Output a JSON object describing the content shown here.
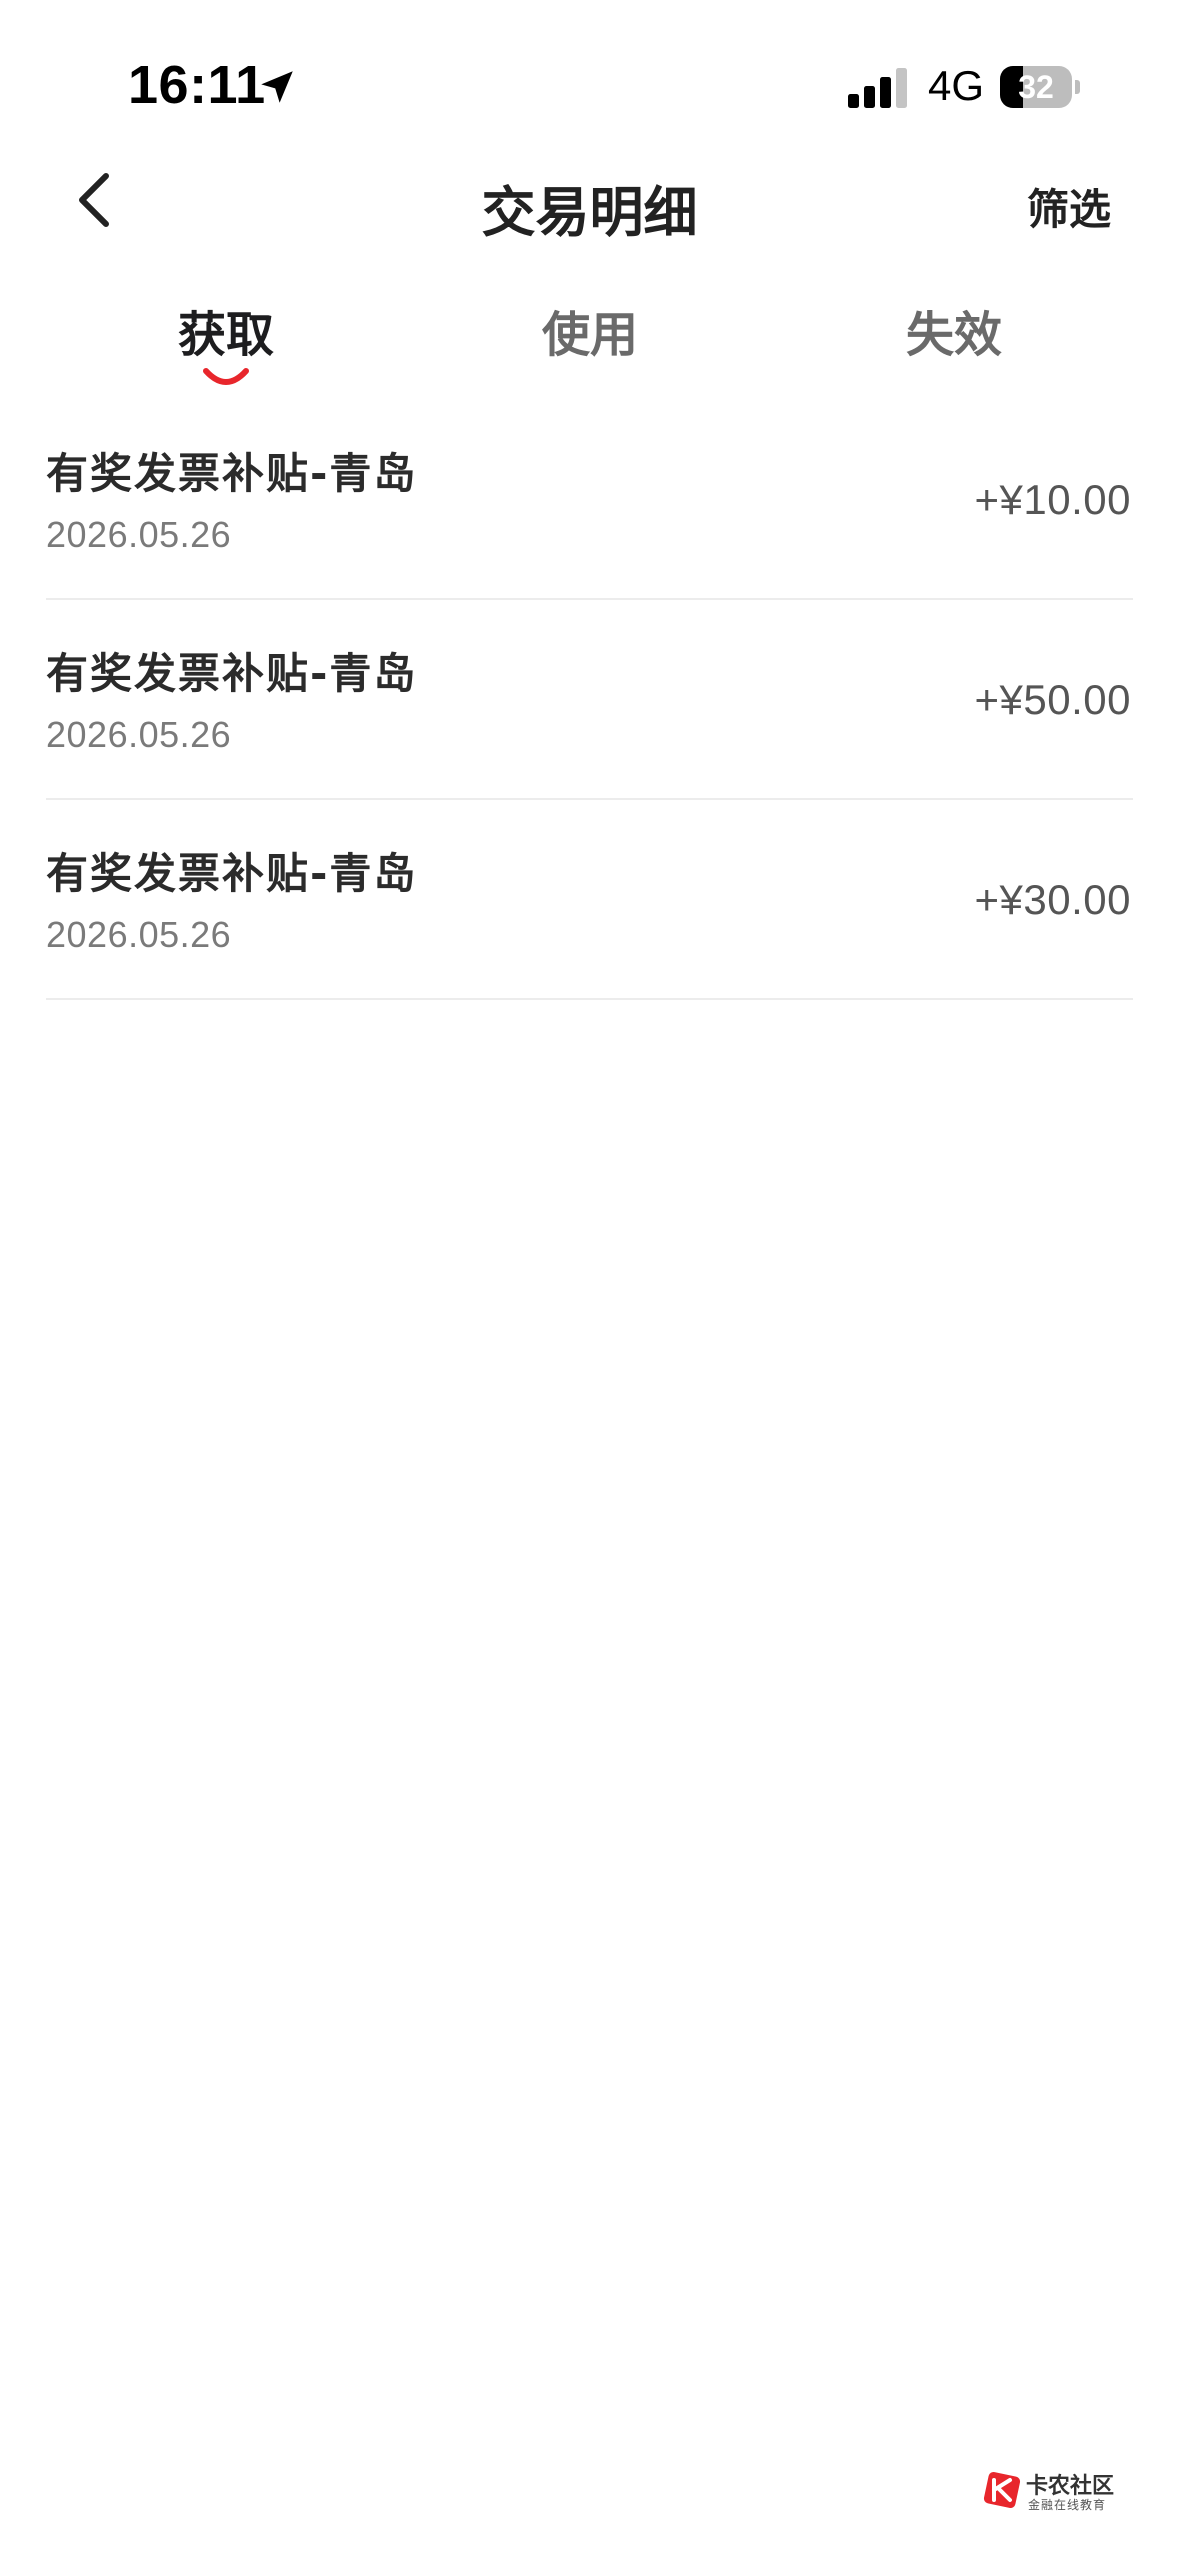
{
  "status_bar": {
    "time": "16:11",
    "network": "4G",
    "battery_level": "32",
    "battery_fraction": 0.32,
    "signal_bars_active": 3,
    "signal_bars_total": 4
  },
  "header": {
    "title": "交易明细",
    "filter_label": "筛选",
    "back_icon": "chevron-left-icon"
  },
  "tabs": [
    {
      "label": "获取",
      "active": true
    },
    {
      "label": "使用",
      "active": false
    },
    {
      "label": "失效",
      "active": false
    }
  ],
  "transactions": [
    {
      "title": "有奖发票补贴-青岛",
      "date": "2026.05.26",
      "amount": "+¥10.00"
    },
    {
      "title": "有奖发票补贴-青岛",
      "date": "2026.05.26",
      "amount": "+¥50.00"
    },
    {
      "title": "有奖发票补贴-青岛",
      "date": "2026.05.26",
      "amount": "+¥30.00"
    }
  ],
  "watermark": {
    "name": "卡农社区",
    "tagline": "金融在线教育"
  },
  "colors": {
    "accent": "#e8262c",
    "text_primary": "#222222",
    "text_secondary": "#7a7a7a",
    "divider": "#ececec"
  }
}
